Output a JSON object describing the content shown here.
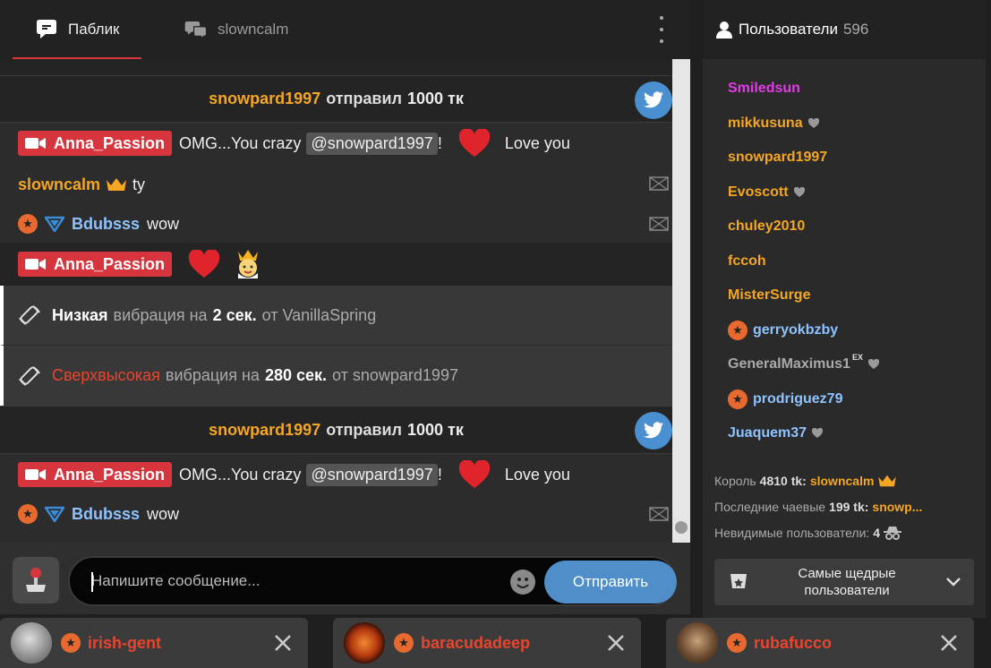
{
  "tabs": {
    "public": "Паблик",
    "private": "slowncalm"
  },
  "messages": {
    "tip1": {
      "user": "snowpard1997",
      "verb": "отправил",
      "amount": "1000 тк"
    },
    "model_name": "Anna_Passion",
    "m1_text": "OMG...You crazy",
    "m1_mention": "@snowpard1997",
    "m1_bang": "!",
    "m1_love": "Love you",
    "m2_user": "slowncalm",
    "m2_text": "ty",
    "m3_user": "Bdubsss",
    "m3_text": "wow",
    "vib1": {
      "level": "Низкая",
      "word": "вибрация на",
      "secs": "2 сек.",
      "from": "от VanillaSpring"
    },
    "vib2": {
      "level": "Сверхвысокая",
      "word": "вибрация на",
      "secs": "280 сек.",
      "from": "от snowpard1997"
    },
    "tip2": {
      "user": "snowpard1997",
      "verb": "отправил",
      "amount": "1000 тк"
    },
    "m5_text": "OMG...You crazy",
    "m5_mention": "@snowpard1997",
    "m5_bang": "!",
    "m5_love": "Love you",
    "m6_user": "Bdubsss",
    "m6_text": "wow"
  },
  "composer": {
    "placeholder": "Напишите сообщение...",
    "send": "Отправить"
  },
  "users": {
    "title": "Пользователи",
    "count": "596",
    "list": [
      {
        "name": "Smiledsun",
        "color": "#e23ce8"
      },
      {
        "name": "mikkusuna",
        "color": "#f5a623"
      },
      {
        "name": "snowpard1997",
        "color": "#f5a623"
      },
      {
        "name": "Evoscott",
        "color": "#f5a623"
      },
      {
        "name": "chuley2010",
        "color": "#f5a623"
      },
      {
        "name": "fccoh",
        "color": "#f5a623"
      },
      {
        "name": "MisterSurge",
        "color": "#f5a623"
      },
      {
        "name": "gerryokbzby",
        "color": "#8ec3ff"
      },
      {
        "name": "GeneralMaximus1",
        "sup": "EX",
        "color": "#aaaaaa"
      },
      {
        "name": "prodriguez79",
        "color": "#8ec3ff"
      },
      {
        "name": "Juaquem37",
        "color": "#8ec3ff"
      }
    ],
    "king_label": "Король",
    "king_amount": "4810 tk:",
    "king_user": "slowncalm",
    "last_label": "Последние чаевые",
    "last_amount": "199 tk:",
    "last_user": "snowp...",
    "invisible_label": "Невидимые пользователи:",
    "invisible_count": "4",
    "generous_line1": "Самые щедрые",
    "generous_line2": "пользователи"
  },
  "private_tabs": [
    {
      "name": "irish-gent"
    },
    {
      "name": "baracudadeep"
    },
    {
      "name": "rubafucco"
    }
  ]
}
